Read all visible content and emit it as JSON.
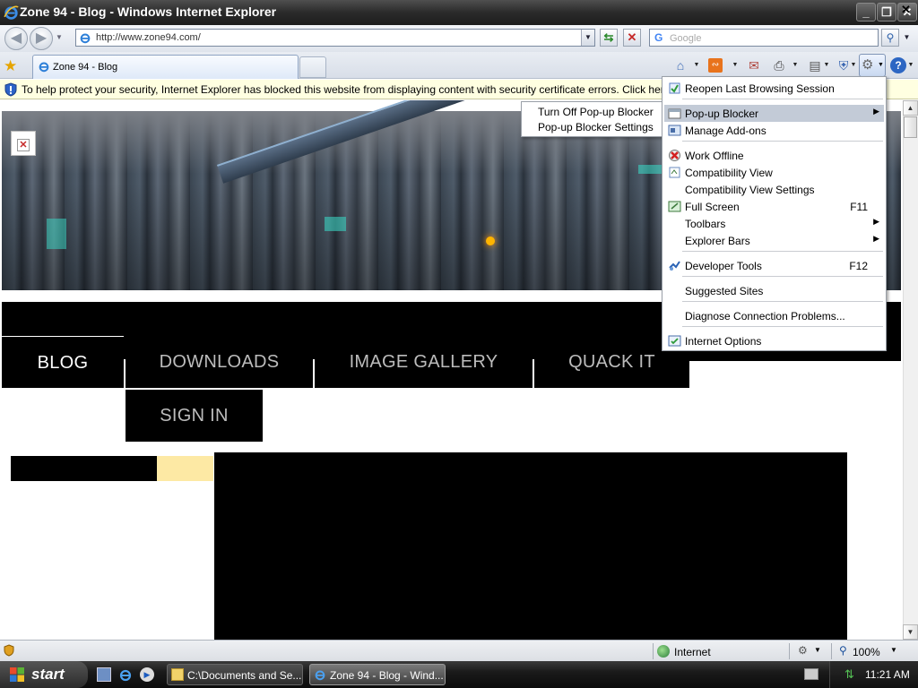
{
  "window": {
    "title": "Zone 94 - Blog - Windows Internet Explorer",
    "minimize": "_",
    "restore": "❐",
    "close": "✕"
  },
  "addressbar": {
    "url": "http://www.zone94.com/",
    "search_placeholder": "Google",
    "search_brand": "G"
  },
  "tabs": [
    {
      "label": "Zone 94 - Blog",
      "active": true
    }
  ],
  "infobar": {
    "text": "To help protect your security, Internet Explorer has blocked this website from displaying content with security certificate errors. Click here for option",
    "close": "✕"
  },
  "site": {
    "nav": [
      "BLOG",
      "DOWNLOADS",
      "IMAGE GALLERY",
      "QUACK IT",
      "SIGN IN"
    ],
    "broken_image_glyph": "✕"
  },
  "tools_menu": {
    "items": [
      {
        "label": "Reopen Last Browsing Session",
        "icon": "reopen-icon",
        "shortcut": "",
        "submenu": false
      },
      {
        "label": "Pop-up Blocker",
        "icon": "popup-blocker-icon",
        "shortcut": "",
        "submenu": true,
        "highlighted": true
      },
      {
        "label": "Manage Add-ons",
        "icon": "addons-icon",
        "shortcut": "",
        "submenu": false
      },
      {
        "label": "Work Offline",
        "icon": "work-offline-icon",
        "shortcut": "",
        "submenu": false
      },
      {
        "label": "Compatibility View",
        "icon": "compatibility-view-icon",
        "shortcut": "",
        "submenu": false
      },
      {
        "label": "Compatibility View Settings",
        "icon": "",
        "shortcut": "",
        "submenu": false
      },
      {
        "label": "Full Screen",
        "icon": "full-screen-icon",
        "shortcut": "F11",
        "submenu": false
      },
      {
        "label": "Toolbars",
        "icon": "",
        "shortcut": "",
        "submenu": true
      },
      {
        "label": "Explorer Bars",
        "icon": "",
        "shortcut": "",
        "submenu": true
      },
      {
        "label": "Developer Tools",
        "icon": "developer-tools-icon",
        "shortcut": "F12",
        "submenu": false
      },
      {
        "label": "Suggested Sites",
        "icon": "",
        "shortcut": "",
        "submenu": false
      },
      {
        "label": "Diagnose Connection Problems...",
        "icon": "",
        "shortcut": "",
        "submenu": false
      },
      {
        "label": "Internet Options",
        "icon": "internet-options-icon",
        "shortcut": "",
        "submenu": false
      }
    ]
  },
  "popup_submenu": {
    "items": [
      "Turn Off Pop-up Blocker",
      "Pop-up Blocker Settings"
    ]
  },
  "statusbar": {
    "zone": "Internet",
    "zoom": "100%"
  },
  "taskbar": {
    "start": "start",
    "tasks": [
      {
        "label": "C:\\Documents and Se...",
        "icon": "folder-icon"
      },
      {
        "label": "Zone 94 - Blog - Wind...",
        "icon": "ie-icon",
        "active": true
      }
    ],
    "clock": "11:21 AM"
  }
}
